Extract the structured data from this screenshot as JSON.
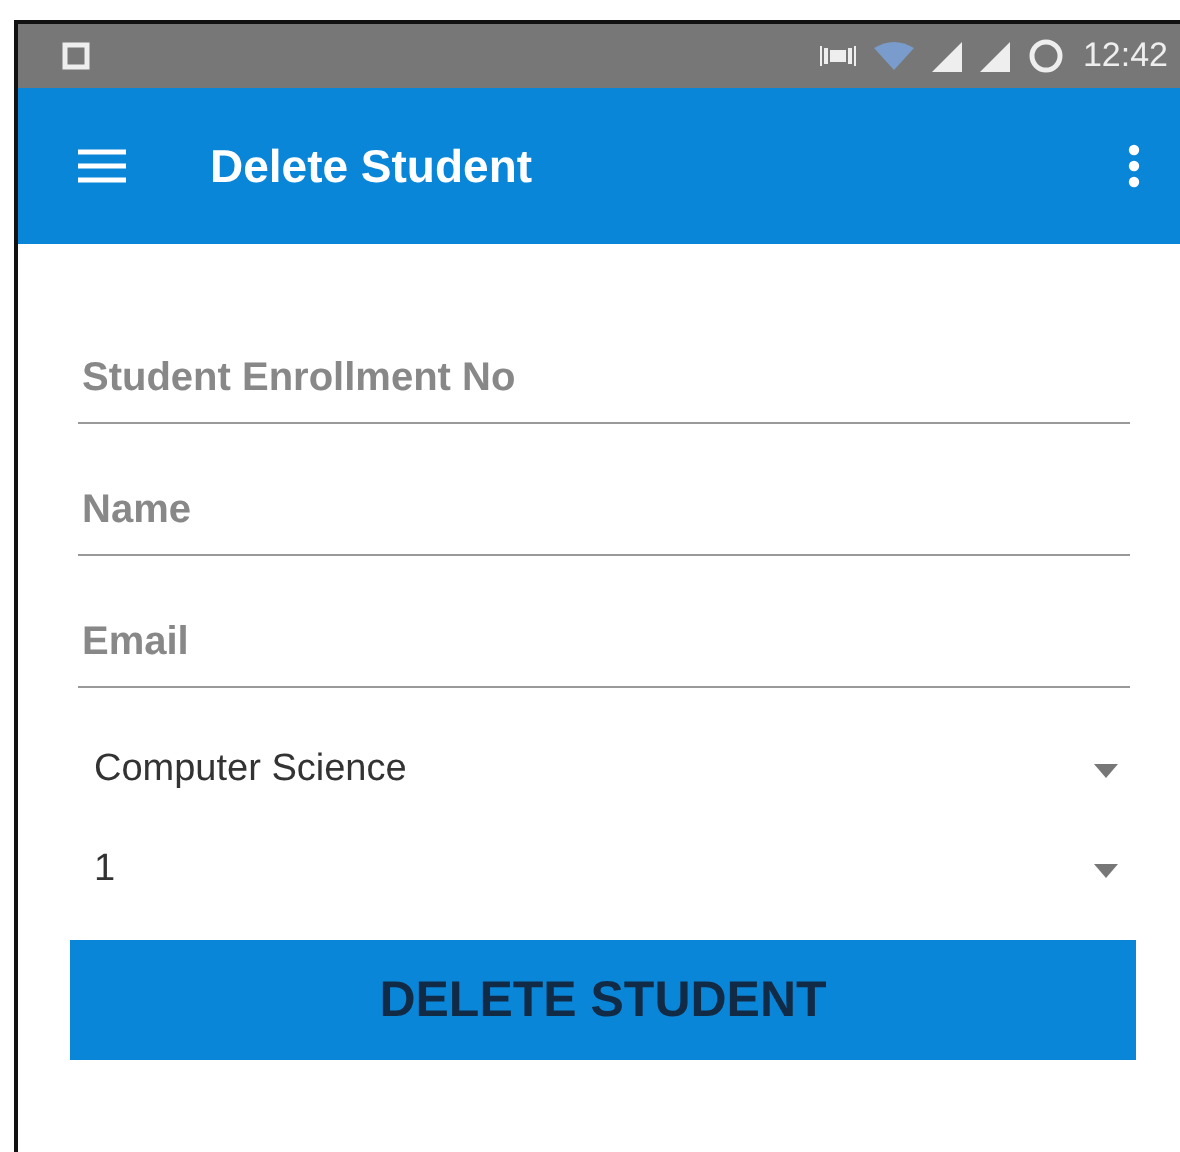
{
  "status_bar": {
    "time": "12:42"
  },
  "app_bar": {
    "title": "Delete Student"
  },
  "fields": [
    {
      "placeholder": "Student Enrollment No"
    },
    {
      "placeholder": "Name"
    },
    {
      "placeholder": "Email"
    }
  ],
  "dropdowns": [
    {
      "value": "Computer Science"
    },
    {
      "value": "1"
    }
  ],
  "button": {
    "label": "DELETE STUDENT"
  }
}
